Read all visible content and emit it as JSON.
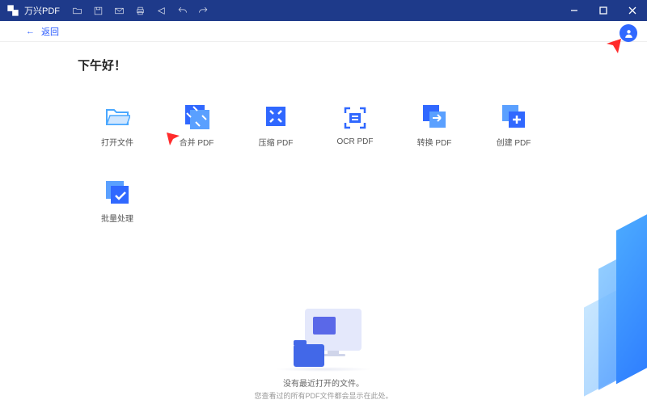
{
  "titlebar": {
    "app_name": "万兴PDF"
  },
  "back": {
    "label": "返回"
  },
  "greeting": "下午好！",
  "tiles": {
    "open": {
      "label": "打开文件"
    },
    "merge": {
      "label": "合并 PDF"
    },
    "compress": {
      "label": "压缩 PDF"
    },
    "ocr": {
      "label": "OCR PDF"
    },
    "convert": {
      "label": "转换 PDF"
    },
    "create": {
      "label": "创建 PDF"
    },
    "batch": {
      "label": "批量处理"
    }
  },
  "empty": {
    "title": "没有最近打开的文件。",
    "subtitle": "您查看过的所有PDF文件都会显示在此处。"
  },
  "colors": {
    "accent": "#3068ff",
    "titlebar": "#1e3a8a",
    "arrow": "#ff2b2b"
  }
}
